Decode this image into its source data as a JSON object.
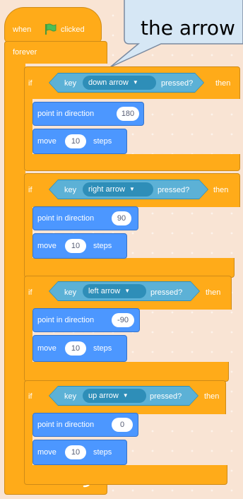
{
  "hat": {
    "when": "when",
    "clicked": "clicked",
    "flag_icon": "green-flag-icon"
  },
  "forever_label": "forever",
  "callout_text": "the arrow",
  "colors": {
    "control": "#ffab19",
    "motion": "#4c97ff",
    "sensing": "#5cb1d6",
    "flag": "#4cbf56"
  },
  "if_blocks": [
    {
      "if_label": "if",
      "key_label": "key",
      "key_option": "down arrow",
      "pressed_label": "pressed?",
      "then_label": "then",
      "point_label": "point in direction",
      "direction": "180",
      "move_label": "move",
      "steps_value": "10",
      "steps_label": "steps"
    },
    {
      "if_label": "if",
      "key_label": "key",
      "key_option": "right arrow",
      "pressed_label": "pressed?",
      "then_label": "then",
      "point_label": "point in direction",
      "direction": "90",
      "move_label": "move",
      "steps_value": "10",
      "steps_label": "steps"
    },
    {
      "if_label": "if",
      "key_label": "key",
      "key_option": "left arrow",
      "pressed_label": "pressed?",
      "then_label": "then",
      "point_label": "point in direction",
      "direction": "-90",
      "move_label": "move",
      "steps_value": "10",
      "steps_label": "steps"
    },
    {
      "if_label": "if",
      "key_label": "key",
      "key_option": "up arrow",
      "pressed_label": "pressed?",
      "then_label": "then",
      "point_label": "point in direction",
      "direction": "0",
      "move_label": "move",
      "steps_value": "10",
      "steps_label": "steps"
    }
  ],
  "loop_arrow_icon": "loop-arrow-icon"
}
